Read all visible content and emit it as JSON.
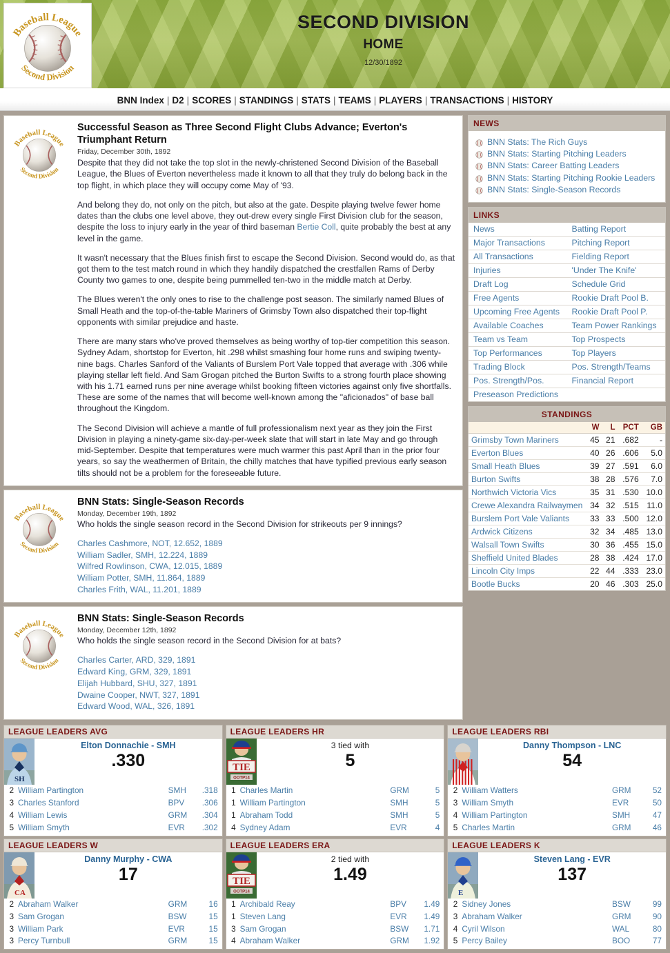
{
  "header": {
    "title": "SECOND DIVISION",
    "subtitle": "HOME",
    "date": "12/30/1892",
    "logo_alt": "Baseball League Second Division"
  },
  "nav": {
    "items": [
      "BNN Index",
      "D2",
      "SCORES",
      "STANDINGS",
      "STATS",
      "TEAMS",
      "PLAYERS",
      "TRANSACTIONS",
      "HISTORY"
    ]
  },
  "articles": [
    {
      "headline": "Successful Season as Three Second Flight Clubs Advance; Everton's Triumphant Return",
      "date": "Friday, December 30th, 1892",
      "paragraphs": [
        "Despite that they did not take the top slot in the newly-christened Second Division of the Baseball League, the Blues of Everton nevertheless made it known to all that they truly do belong back in the top flight, in which place they will occupy come May of '93.",
        "It wasn't necessary that the Blues finish first to escape the Second Division. Second would do, as that got them to the test match round in which they handily dispatched the crestfallen Rams of Derby County two games to one, despite being pummelled ten-two in the middle match at Derby.",
        "The Blues weren't the only ones to rise to the challenge post season. The similarly named Blues of Small Heath and the top-of-the-table Mariners of Grimsby Town also dispatched their top-flight opponents with similar prejudice and haste.",
        "There are many stars who've proved themselves as being worthy of top-tier competition this season. Sydney Adam, shortstop for Everton, hit .298 whilst smashing four home runs and swiping twenty-nine bags. Charles Sanford of the Valiants of Burslem Port Vale topped that average with .306 while playing stellar left field. And Sam Grogan pitched the Burton Swifts to a strong fourth place showing with his 1.71 earned runs per nine average whilst booking fifteen victories against only five shortfalls. These are some of the names that will become well-known among the \"aficionados\" of base ball throughout the Kingdom.",
        "The Second Division will achieve a mantle of full professionalism next year as they join the First Division in playing a ninety-game six-day-per-week slate that will start in late May and go through mid-September. Despite that temperatures were much warmer this past April than in the prior four years, so say the weathermen of Britain, the chilly matches that have typified previous early season tilts should not be a problem for the foreseeable future."
      ],
      "para2_a": "And belong they do, not only on the pitch, but also at the gate. Despite playing twelve fewer home dates than the clubs one level above, they out-drew every single First Division club for the season, despite the loss to injury early in the year of third baseman ",
      "para2_link": "Bertie Coll",
      "para2_b": ", quite probably the best at any level in the game."
    }
  ],
  "records": [
    {
      "headline": "BNN Stats: Single-Season Records",
      "date": "Monday, December 19th, 1892",
      "question": "Who holds the single season record in the Second Division for strikeouts per 9 innings?",
      "lines": [
        "Charles Cashmore, NOT, 12.652, 1889",
        "William Sadler, SMH, 12.224, 1889",
        "Wilfred Rowlinson, CWA, 12.015, 1889",
        "William Potter, SMH, 11.864, 1889",
        "Charles Frith, WAL, 11.201, 1889"
      ]
    },
    {
      "headline": "BNN Stats: Single-Season Records",
      "date": "Monday, December 12th, 1892",
      "question": "Who holds the single season record in the Second Division for at bats?",
      "lines": [
        "Charles Carter, ARD, 329, 1891",
        "Edward King, GRM, 329, 1891",
        "Elijah Hubbard, SHU, 327, 1891",
        "Dwaine Cooper, NWT, 327, 1891",
        "Edward Wood, WAL, 326, 1891"
      ]
    }
  ],
  "news": {
    "title": "NEWS",
    "items": [
      "BNN Stats: The Rich Guys",
      "BNN Stats: Starting Pitching Leaders",
      "BNN Stats: Career Batting Leaders",
      "BNN Stats: Starting Pitching Rookie Leaders",
      "BNN Stats: Single-Season Records"
    ]
  },
  "links": {
    "title": "LINKS",
    "rows": [
      [
        "News",
        "Batting Report"
      ],
      [
        "Major Transactions",
        "Pitching Report"
      ],
      [
        "All Transactions",
        "Fielding Report"
      ],
      [
        "Injuries",
        "'Under The Knife'"
      ],
      [
        "Draft Log",
        "Schedule Grid"
      ],
      [
        "Free Agents",
        "Rookie Draft Pool B."
      ],
      [
        "Upcoming Free Agents",
        "Rookie Draft Pool P."
      ],
      [
        "Available Coaches",
        "Team Power Rankings"
      ],
      [
        "Team vs Team",
        "Top Prospects"
      ],
      [
        "Top Performances",
        "Top Players"
      ],
      [
        "Trading Block",
        "Pos. Strength/Teams"
      ],
      [
        "Pos. Strength/Pos.",
        "Financial Report"
      ],
      [
        "Preseason Predictions",
        ""
      ]
    ]
  },
  "standings": {
    "title": "STANDINGS",
    "columns": [
      "",
      "W",
      "L",
      "PCT",
      "GB"
    ],
    "rows": [
      {
        "team": "Grimsby Town Mariners",
        "w": "45",
        "l": "21",
        "pct": ".682",
        "gb": "-"
      },
      {
        "team": "Everton Blues",
        "w": "40",
        "l": "26",
        "pct": ".606",
        "gb": "5.0"
      },
      {
        "team": "Small Heath Blues",
        "w": "39",
        "l": "27",
        "pct": ".591",
        "gb": "6.0"
      },
      {
        "team": "Burton Swifts",
        "w": "38",
        "l": "28",
        "pct": ".576",
        "gb": "7.0"
      },
      {
        "team": "Northwich Victoria Vics",
        "w": "35",
        "l": "31",
        "pct": ".530",
        "gb": "10.0"
      },
      {
        "team": "Crewe Alexandra Railwaymen",
        "w": "34",
        "l": "32",
        "pct": ".515",
        "gb": "11.0"
      },
      {
        "team": "Burslem Port Vale Valiants",
        "w": "33",
        "l": "33",
        "pct": ".500",
        "gb": "12.0"
      },
      {
        "team": "Ardwick Citizens",
        "w": "32",
        "l": "34",
        "pct": ".485",
        "gb": "13.0"
      },
      {
        "team": "Walsall Town Swifts",
        "w": "30",
        "l": "36",
        "pct": ".455",
        "gb": "15.0"
      },
      {
        "team": "Sheffield United Blades",
        "w": "28",
        "l": "38",
        "pct": ".424",
        "gb": "17.0"
      },
      {
        "team": "Lincoln City Imps",
        "w": "22",
        "l": "44",
        "pct": ".333",
        "gb": "23.0"
      },
      {
        "team": "Bootle Bucks",
        "w": "20",
        "l": "46",
        "pct": ".303",
        "gb": "25.0"
      }
    ]
  },
  "leaders": [
    {
      "title": "LEAGUE LEADERS AVG",
      "tie": false,
      "leader_name": "Elton Donnachie",
      "leader_team": "SMH",
      "value": ".330",
      "portrait": "player-light-blue",
      "rows": [
        {
          "rank": "2",
          "name": "William Partington",
          "team": "SMH",
          "stat": ".318"
        },
        {
          "rank": "3",
          "name": "Charles Stanford",
          "team": "BPV",
          "stat": ".306"
        },
        {
          "rank": "4",
          "name": "William Lewis",
          "team": "GRM",
          "stat": ".304"
        },
        {
          "rank": "5",
          "name": "William Smyth",
          "team": "EVR",
          "stat": ".302"
        }
      ]
    },
    {
      "title": "LEAGUE LEADERS HR",
      "tie": true,
      "tie_text": "3 tied with",
      "value": "5",
      "portrait": "tie",
      "rows": [
        {
          "rank": "1",
          "name": "Charles Martin",
          "team": "GRM",
          "stat": "5"
        },
        {
          "rank": "1",
          "name": "William Partington",
          "team": "SMH",
          "stat": "5"
        },
        {
          "rank": "1",
          "name": "Abraham Todd",
          "team": "SMH",
          "stat": "5"
        },
        {
          "rank": "4",
          "name": "Sydney Adam",
          "team": "EVR",
          "stat": "4"
        }
      ]
    },
    {
      "title": "LEAGUE LEADERS RBI",
      "tie": false,
      "leader_name": "Danny Thompson",
      "leader_team": "LNC",
      "value": "54",
      "portrait": "player-red-stripe",
      "rows": [
        {
          "rank": "2",
          "name": "William Watters",
          "team": "GRM",
          "stat": "52"
        },
        {
          "rank": "3",
          "name": "William Smyth",
          "team": "EVR",
          "stat": "50"
        },
        {
          "rank": "4",
          "name": "William Partington",
          "team": "SMH",
          "stat": "47"
        },
        {
          "rank": "5",
          "name": "Charles Martin",
          "team": "GRM",
          "stat": "46"
        }
      ]
    },
    {
      "title": "LEAGUE LEADERS W",
      "tie": false,
      "leader_name": "Danny Murphy",
      "leader_team": "CWA",
      "value": "17",
      "portrait": "player-cream-red",
      "rows": [
        {
          "rank": "2",
          "name": "Abraham Walker",
          "team": "GRM",
          "stat": "16"
        },
        {
          "rank": "3",
          "name": "Sam Grogan",
          "team": "BSW",
          "stat": "15"
        },
        {
          "rank": "3",
          "name": "William Park",
          "team": "EVR",
          "stat": "15"
        },
        {
          "rank": "3",
          "name": "Percy Turnbull",
          "team": "GRM",
          "stat": "15"
        }
      ]
    },
    {
      "title": "LEAGUE LEADERS ERA",
      "tie": true,
      "tie_text": "2 tied with",
      "value": "1.49",
      "portrait": "tie",
      "rows": [
        {
          "rank": "1",
          "name": "Archibald Reay",
          "team": "BPV",
          "stat": "1.49"
        },
        {
          "rank": "1",
          "name": "Steven Lang",
          "team": "EVR",
          "stat": "1.49"
        },
        {
          "rank": "3",
          "name": "Sam Grogan",
          "team": "BSW",
          "stat": "1.71"
        },
        {
          "rank": "4",
          "name": "Abraham Walker",
          "team": "GRM",
          "stat": "1.92"
        }
      ]
    },
    {
      "title": "LEAGUE LEADERS K",
      "tie": false,
      "leader_name": "Steven Lang",
      "leader_team": "EVR",
      "value": "137",
      "portrait": "player-blue-cap",
      "rows": [
        {
          "rank": "2",
          "name": "Sidney Jones",
          "team": "BSW",
          "stat": "99"
        },
        {
          "rank": "3",
          "name": "Abraham Walker",
          "team": "GRM",
          "stat": "90"
        },
        {
          "rank": "4",
          "name": "Cyril Wilson",
          "team": "WAL",
          "stat": "80"
        },
        {
          "rank": "5",
          "name": "Percy Bailey",
          "team": "BOO",
          "stat": "77"
        }
      ]
    }
  ],
  "colors": {
    "accent_red": "#7a1616",
    "link_blue": "#4a7ea8",
    "page_bg": "#a9a096",
    "panel_head": "#c6c0b7",
    "field_green": "#9ab348"
  }
}
